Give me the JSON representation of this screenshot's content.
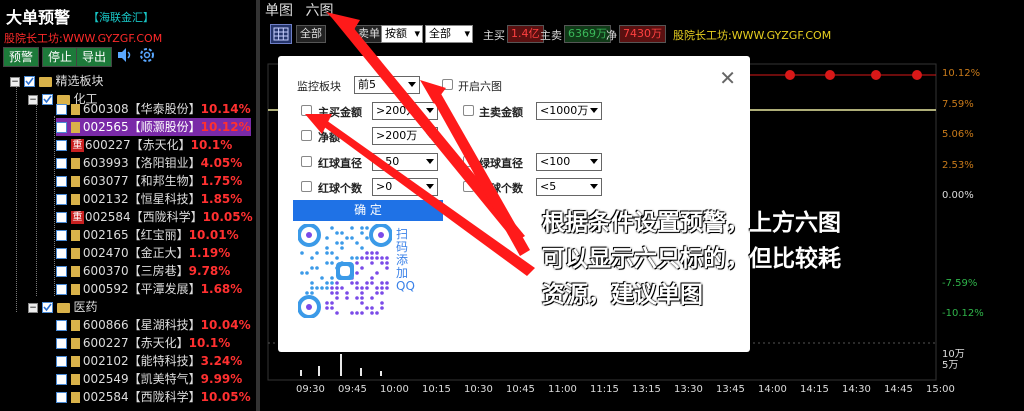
{
  "sidebar": {
    "title": "大单预警",
    "badge": "【海联金汇】",
    "site": "股院长工坊:WWW.GYZGF.COM",
    "buttons": {
      "alert": "预警",
      "stop": "停止",
      "export": "导出"
    },
    "icons": {
      "sound": "speaker-icon",
      "settings": "gear-icon"
    },
    "root": "精选板块",
    "groups": [
      {
        "name": "化工",
        "items": [
          {
            "code": "600308",
            "name": "【华泰股份】",
            "pct": "10.14%",
            "tag": ""
          },
          {
            "code": "002565",
            "name": "【顺灏股份】",
            "pct": "10.12%",
            "tag": "",
            "selected": true
          },
          {
            "code": "600227",
            "name": "【赤天化】",
            "pct": "10.1%",
            "tag": "重"
          },
          {
            "code": "603993",
            "name": "【洛阳钼业】",
            "pct": "4.05%",
            "tag": ""
          },
          {
            "code": "603077",
            "name": "【和邦生物】",
            "pct": "1.75%",
            "tag": ""
          },
          {
            "code": "002132",
            "name": "【恒星科技】",
            "pct": "1.85%",
            "tag": ""
          },
          {
            "code": "002584",
            "name": "【西陇科学】",
            "pct": "10.05%",
            "tag": "重"
          },
          {
            "code": "002165",
            "name": "【红宝丽】",
            "pct": "10.01%",
            "tag": ""
          },
          {
            "code": "002470",
            "name": "【金正大】",
            "pct": "1.19%",
            "tag": ""
          },
          {
            "code": "600370",
            "name": "【三房巷】",
            "pct": "9.78%",
            "tag": ""
          },
          {
            "code": "000592",
            "name": "【平潭发展】",
            "pct": "1.68%",
            "tag": ""
          }
        ]
      },
      {
        "name": "医药",
        "items": [
          {
            "code": "600866",
            "name": "【星湖科技】",
            "pct": "10.04%",
            "tag": ""
          },
          {
            "code": "600227",
            "name": "【赤天化】",
            "pct": "10.1%",
            "tag": ""
          },
          {
            "code": "002102",
            "name": "【能特科技】",
            "pct": "3.24%",
            "tag": ""
          },
          {
            "code": "002549",
            "name": "【凯美特气】",
            "pct": "9.99%",
            "tag": ""
          },
          {
            "code": "002584",
            "name": "【西陇科学】",
            "pct": "10.05%",
            "tag": ""
          }
        ]
      }
    ]
  },
  "tabs": {
    "single": "单图",
    "six": "六图"
  },
  "toolbar": {
    "all1": "全部",
    "label_buysell": "卖单",
    "sort_select": "按额",
    "scope_select": "全部",
    "buy_label": "主买",
    "buy_value": "1.4亿",
    "sell_label": "主卖",
    "sell_value": "6369万",
    "net_label": "净",
    "net_value": "7430万",
    "site": "股院长工坊:WWW.GYZGF.COM"
  },
  "chart": {
    "y_labels": [
      "10.12%",
      "7.59%",
      "5.06%",
      "2.53%",
      "0.00%",
      "-7.59%",
      "-10.12%"
    ],
    "vol_labels": [
      "10万",
      "5万"
    ],
    "x_labels": [
      "09:30",
      "09:45",
      "10:00",
      "10:15",
      "10:30",
      "10:45",
      "11:00",
      "11:15",
      "13:15",
      "13:30",
      "13:45",
      "14:00",
      "14:15",
      "14:30",
      "14:45",
      "15:00"
    ]
  },
  "dialog": {
    "monitor_label": "监控板块",
    "monitor_value": "前5",
    "six_label": "开启六图",
    "rows": [
      {
        "left_label": "主买金额",
        "left_value": ">200万",
        "right_label": "主卖金额",
        "right_value": "<1000万"
      },
      {
        "left_label": "净额",
        "left_value": ">200万",
        "right_label": "",
        "right_value": ""
      },
      {
        "left_label": "红球直径",
        "left_value": ">50",
        "right_label": "绿球直径",
        "right_value": "<100"
      },
      {
        "left_label": "红球个数",
        "left_value": ">0",
        "right_label": "绿球个数",
        "right_value": "<5"
      }
    ],
    "ok": "确 定",
    "qr_text": "扫码添加QQ"
  },
  "annotation": {
    "line1": "根据条件设置预警，上方六图",
    "line2": "可以显示六只标的，但比较耗",
    "line3": "资源，建议单图"
  },
  "colors": {
    "up": "#ff3030",
    "select": "#7a2aa8",
    "accent": "#1f72e6",
    "arrow": "#ff1a1a",
    "button_green": "#1d7a3a"
  }
}
